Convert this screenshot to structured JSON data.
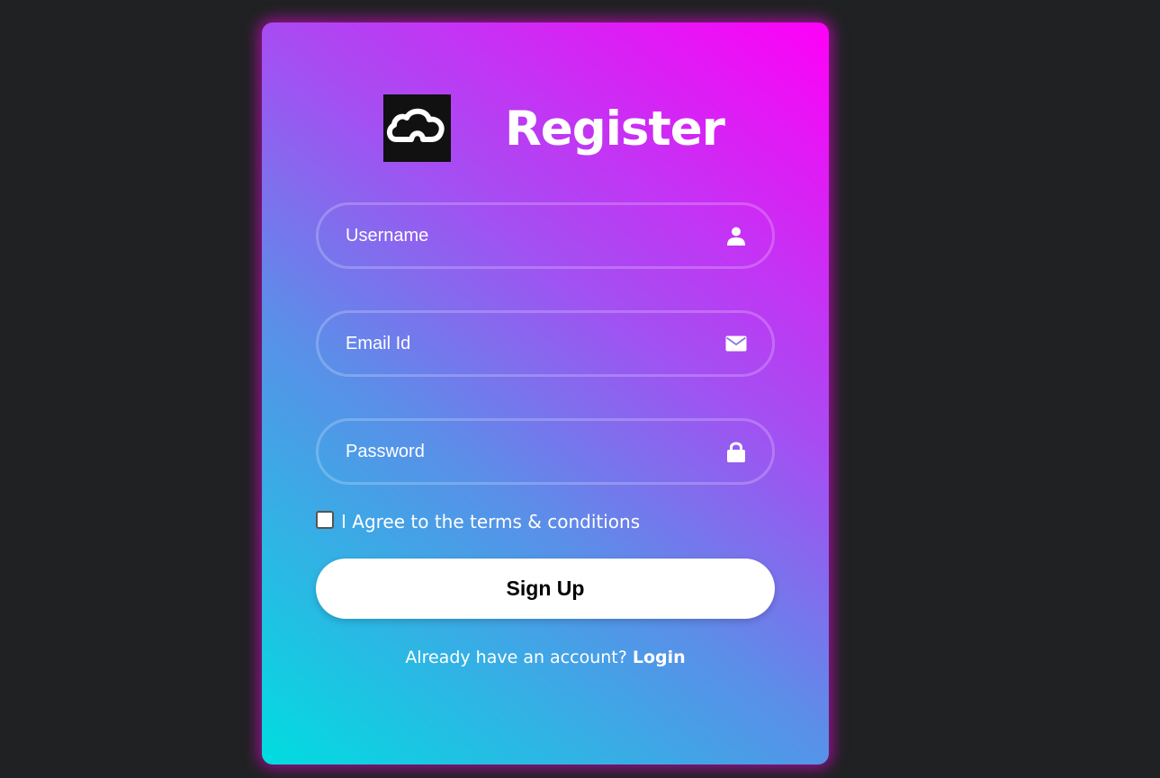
{
  "form": {
    "title": "Register",
    "fields": {
      "username": {
        "placeholder": "Username",
        "value": "",
        "icon": "user-icon"
      },
      "email": {
        "placeholder": "Email Id",
        "value": "",
        "icon": "envelope-icon"
      },
      "password": {
        "placeholder": "Password",
        "value": "",
        "icon": "lock-icon"
      }
    },
    "agree": {
      "label": "I Agree to the terms & conditions",
      "checked": false
    },
    "submit_label": "Sign Up",
    "footer": {
      "text": "Already have an account?",
      "link_label": "Login"
    }
  },
  "logo": {
    "icon": "cloud-icon"
  },
  "colors": {
    "page_background": "#202123",
    "gradient_start": "#00dde0",
    "gradient_mid": "#a44ff2",
    "gradient_end": "#ff00f7",
    "button_background": "#ffffff",
    "logo_background": "#111111"
  }
}
